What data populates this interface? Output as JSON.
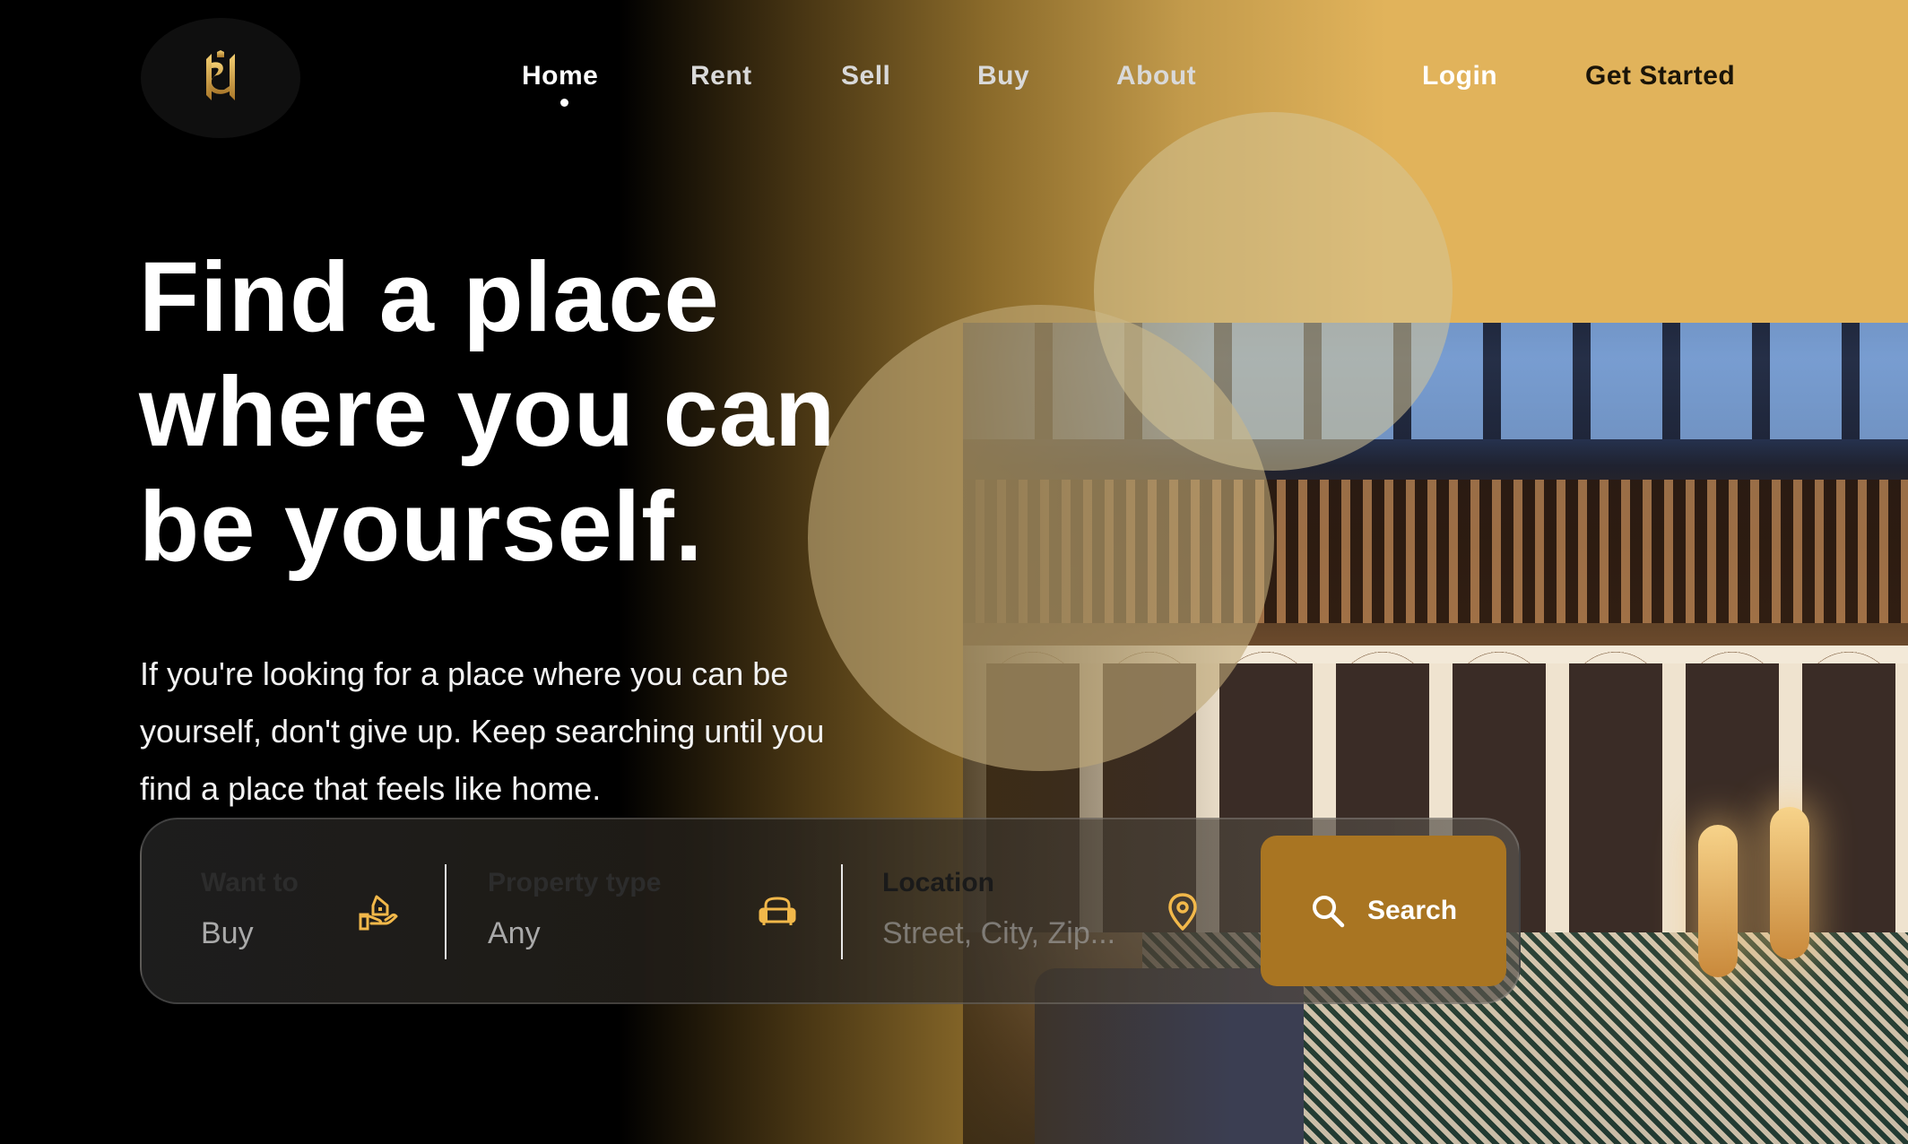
{
  "nav": {
    "logo_icon": "monogram-logo",
    "links": [
      {
        "label": "Home",
        "active": true
      },
      {
        "label": "Rent"
      },
      {
        "label": "Sell"
      },
      {
        "label": "Buy"
      },
      {
        "label": "About"
      }
    ],
    "login_label": "Login",
    "get_started_label": "Get Started"
  },
  "hero": {
    "title_lines": [
      "Find a place",
      "where you can",
      "be yourself."
    ],
    "subtitle_lines": [
      "If you're looking for a place where you can be",
      "yourself, don't give up. Keep searching until you",
      "find a place that feels like home."
    ]
  },
  "search": {
    "want_to": {
      "label": "Want to",
      "value": "Buy",
      "icon": "hand-house-icon"
    },
    "property_type": {
      "label": "Property type",
      "value": "Any",
      "icon": "sofa-icon"
    },
    "location": {
      "label": "Location",
      "placeholder": "Street, City, Zip...",
      "icon": "map-pin-icon"
    },
    "button_label": "Search",
    "button_icon": "search-icon"
  },
  "colors": {
    "accent_gold": "#e1b35b",
    "button_gold": "#a97522",
    "icon_gold": "#f2b84a",
    "background": "#000000"
  }
}
